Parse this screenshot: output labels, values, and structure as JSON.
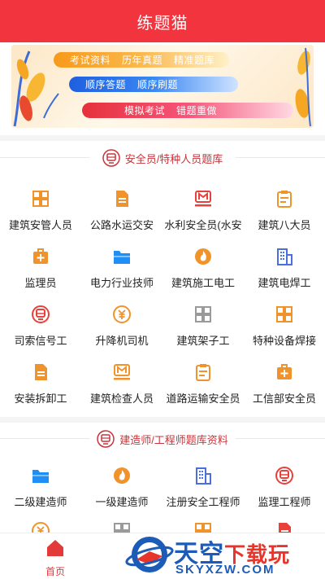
{
  "app": {
    "title": "练题猫"
  },
  "banner": {
    "row1": [
      "考试资料",
      "历年真题",
      "精准题库"
    ],
    "row2": [
      "顺序答题",
      "顺序刷题"
    ],
    "row3": [
      "模拟考试",
      "错题重做"
    ]
  },
  "section1": {
    "title": "安全员/特种人员题库",
    "items": [
      {
        "label": "建筑安管人员",
        "icon": "grid-icon",
        "color": "#f0932b"
      },
      {
        "label": "公路水运交安",
        "icon": "document-icon",
        "color": "#f0932b"
      },
      {
        "label": "水利安全员(水安",
        "icon": "m-badge-icon",
        "color": "#e8403b"
      },
      {
        "label": "建筑八大员",
        "icon": "clipboard-icon",
        "color": "#f0932b"
      },
      {
        "label": "监理员",
        "icon": "medical-kit-icon",
        "color": "#f0932b"
      },
      {
        "label": "电力行业技师",
        "icon": "folder-icon",
        "color": "#1f8ff5"
      },
      {
        "label": "建筑施工电工",
        "icon": "flame-icon",
        "color": "#f0932b"
      },
      {
        "label": "建筑电焊工",
        "icon": "building-icon",
        "color": "#4a6fe0"
      },
      {
        "label": "司索信号工",
        "icon": "train-icon",
        "color": "#e8403b"
      },
      {
        "label": "升降机司机",
        "icon": "coin-icon",
        "color": "#f0932b"
      },
      {
        "label": "建筑架子工",
        "icon": "grid-icon",
        "color": "#9a9a9a"
      },
      {
        "label": "特种设备焊接",
        "icon": "grid-icon",
        "color": "#f0932b"
      },
      {
        "label": "安装拆卸工",
        "icon": "document-icon",
        "color": "#f0932b"
      },
      {
        "label": "建筑检查人员",
        "icon": "m-badge-icon",
        "color": "#f0932b"
      },
      {
        "label": "道路运输安全员",
        "icon": "clipboard-icon",
        "color": "#f0932b"
      },
      {
        "label": "工信部安全员",
        "icon": "medical-kit-icon",
        "color": "#f0932b"
      }
    ]
  },
  "section2": {
    "title": "建造师/工程师题库资料",
    "items": [
      {
        "label": "二级建造师",
        "icon": "folder-icon",
        "color": "#1f8ff5"
      },
      {
        "label": "一级建造师",
        "icon": "flame-icon",
        "color": "#f0932b"
      },
      {
        "label": "注册安全工程师",
        "icon": "building-icon",
        "color": "#4a6fe0"
      },
      {
        "label": "监理工程师",
        "icon": "train-icon",
        "color": "#e8403b"
      }
    ],
    "partial_icons": [
      {
        "icon": "coin-icon",
        "color": "#f0932b"
      },
      {
        "icon": "grid-icon",
        "color": "#9a9a9a"
      },
      {
        "icon": "grid-icon",
        "color": "#f0932b"
      },
      {
        "icon": "document-icon",
        "color": "#e8403b"
      }
    ]
  },
  "tabbar": {
    "home_label": "首页",
    "home_icon": "home-icon",
    "active_color": "#e23a3a"
  },
  "watermark": {
    "main": "天空",
    "accent": "下载玩",
    "url": "SKYXZW.COM"
  },
  "colors": {
    "primary": "#f2343f",
    "section_title": "#c8343b"
  }
}
